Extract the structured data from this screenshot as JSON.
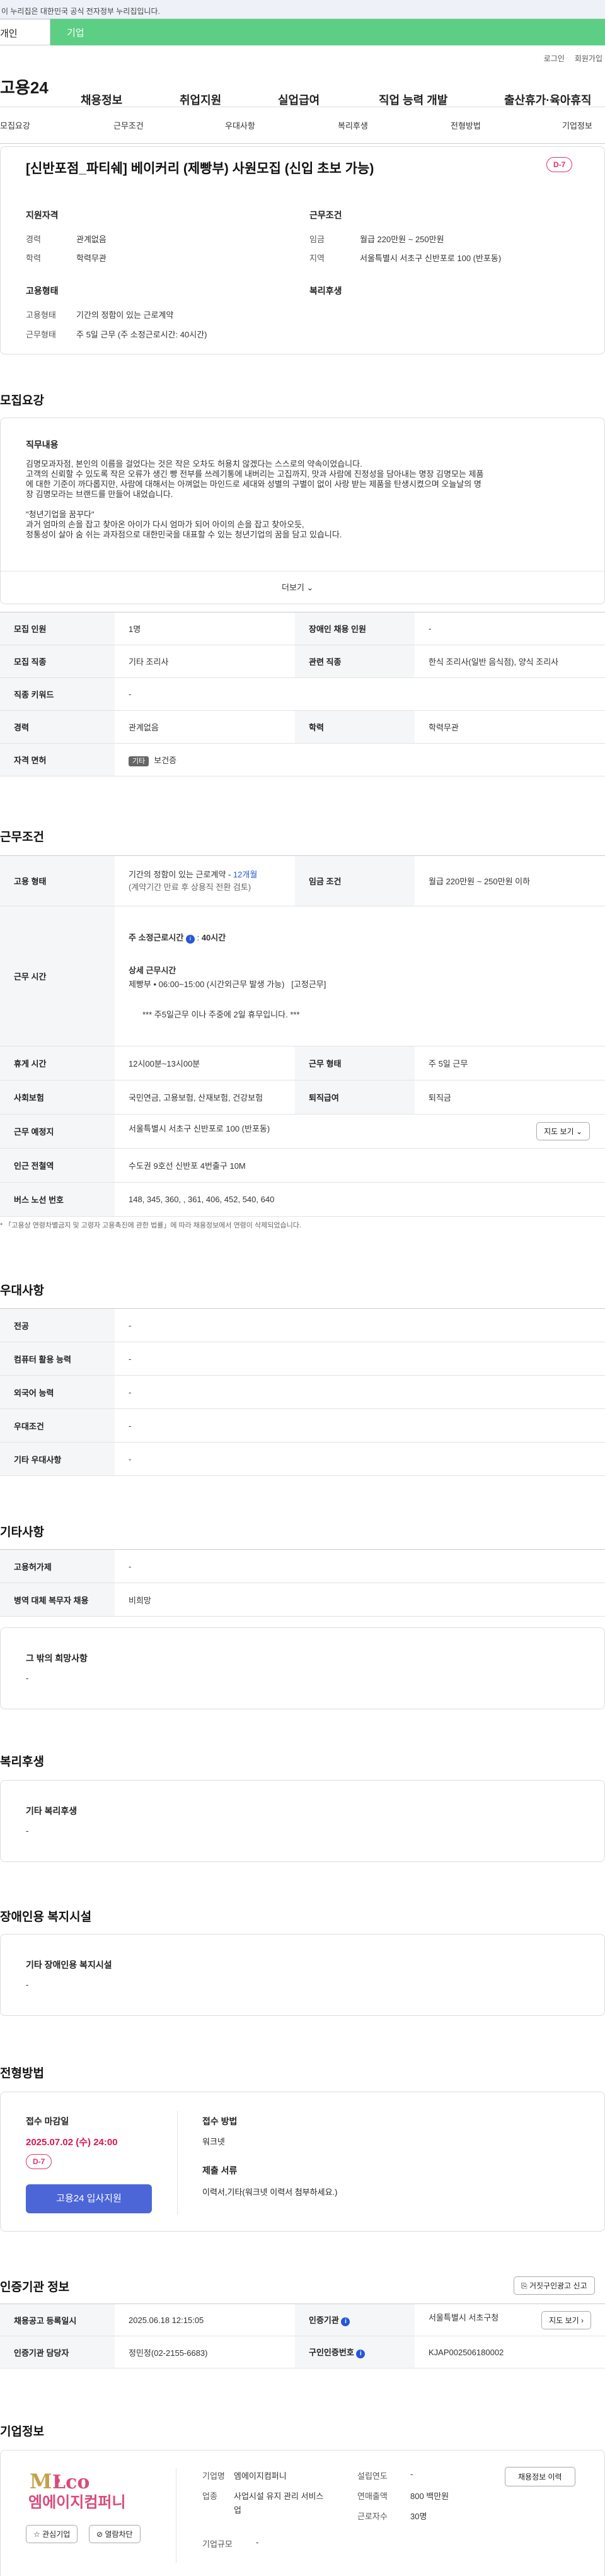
{
  "gov_banner": "이 누리집은 대한민국 공식 전자정부 누리집입니다.",
  "tabs": {
    "individual": "개인",
    "corporate": "기업"
  },
  "top_links": [
    "로그인",
    "회원가입"
  ],
  "logo": "고용24",
  "gnb": [
    "채용정보",
    "취업지원",
    "실업급여",
    "직업 능력 개발",
    "출산휴가·육아휴직"
  ],
  "anchor_nav": [
    "모집요강",
    "근무조건",
    "우대사항",
    "복리후생",
    "전형방법",
    "기업정보"
  ],
  "job": {
    "title": "[신반포점_파티쉐] 베이커리 (제빵부) 사원모집 (신입 초보 가능)",
    "dday": "D-7",
    "qual_title": "지원자격",
    "career_label": "경력",
    "career_value": "관계없음",
    "edu_label": "학력",
    "edu_value": "학력무관",
    "cond_title": "근무조건",
    "wage_label": "임금",
    "wage_value": "월급 220만원 ~ 250만원",
    "area_label": "지역",
    "area_value": "서울특별시 서초구 신반포로 100 (반포동)",
    "emp_title": "고용형태",
    "emp_label": "고용형태",
    "emp_value": "기간의 정함이 있는 근로계약",
    "worktype_label": "근무형태",
    "worktype_value": "주 5일 근무 (주 소정근로시간: 40시간)",
    "welfare_title": "복리후생"
  },
  "recruit": {
    "section_title": "모집요강",
    "duty_title": "직무내용",
    "duty_line1": "김명모과자점, 본인의 이름을 걸었다는 것은 작은 오차도 허용치 않겠다는 스스로의 약속이었습니다.",
    "duty_line2": "고객의 신뢰할 수 있도록 작은 오류가 생긴 빵 전부를 쓰레기통에 내버리는 고집까지, 맛과 사람에 진정성을 담아내는 명장 김명모는 제품",
    "duty_line3": "에 대한 기준이 까다롭지만, 사람에 대해서는 아껴없는 마인드로 세대와 성별의 구별이 없이 사랑 받는 제품을 탄생시켰으며 오늘날의 명",
    "duty_line4": "장 김명모라는 브랜드를 만들어 내었습니다.",
    "duty_line5": "\"청년기업을 꿈꾸다\"",
    "duty_line6": "과거 엄마의 손을 잡고 찾아온 아이가 다시 엄마가 되어 아이의 손을 잡고 찾아오듯,",
    "duty_line7": "정통성이 살아 숨 쉬는 과자점으로 대한민국을 대표할 수 있는 청년기업의 꿈을 담고 있습니다.",
    "more_label": "더보기",
    "rows": [
      {
        "h1": "모집 인원",
        "v1": "1명",
        "h2": "장애인 채용 인원",
        "v2": "-"
      },
      {
        "h1": "모집 직종",
        "v1": "기타 조리사",
        "h2": "관련 직종",
        "v2": "한식 조리사(일반 음식점), 양식 조리사"
      },
      {
        "h1": "직종 키워드",
        "v1": "-",
        "h2": "",
        "v2": ""
      },
      {
        "h1": "경력",
        "v1": "관계없음",
        "h2": "학력",
        "v2": "학력무관"
      }
    ],
    "license_label": "자격 면허",
    "license_badge": "기타",
    "license_value": "보건증"
  },
  "conditions": {
    "section_title": "근무조건",
    "emp_label": "고용 형태",
    "emp_line1_prefix": "기간의 정함이 있는 근로계약 - ",
    "emp_line1_months": "12개월",
    "emp_line2": "(계약기간 만료 후 상용직 전환 검토)",
    "wage_label": "임금 조건",
    "wage_value": "월급 220만원 ~ 250만원 이하",
    "hours_label": "근무 시간",
    "hours_weekly_label": "주 소정근로시간",
    "hours_weekly_value": "40시간",
    "hours_detail_title": "상세 근무시간",
    "hours_detail_line": "제빵부 • 06:00~15:00 (시간외근무 발생 가능)",
    "hours_detail_fixed": "[고정근무]",
    "hours_note": "***   주5일근무 이나   주중에 2일 휴무입니다.   ***",
    "rows": [
      {
        "h1": "휴게 시간",
        "v1": "12시00분~13시00분",
        "h2": "근무 형태",
        "v2": "주 5일 근무"
      },
      {
        "h1": "사회보험",
        "v1": "국민연금, 고용보험, 산재보험, 건강보험",
        "h2": "퇴직급여",
        "v2": "퇴직금"
      }
    ],
    "location_label": "근무 예정지",
    "location_value": "서울특별시 서초구 신반포로 100 (반포동)",
    "map_button": "지도 보기",
    "subway_label": "인근 전철역",
    "subway_value": "수도권 9호선 신반포 4번출구 10M",
    "bus_label": "버스 노선 번호",
    "bus_value": "148, 345, 360, , 361, 406, 452, 540, 640",
    "footnote": "「고용상 연령차별금지 및 고령자 고용촉진에 관한 법률」에 따라 채용정보에서 연령이 삭제되었습니다."
  },
  "preferences": {
    "section_title": "우대사항",
    "rows": [
      {
        "h": "전공",
        "v": "-"
      },
      {
        "h": "컴퓨터 활용 능력",
        "v": "-"
      },
      {
        "h": "외국어 능력",
        "v": "-"
      },
      {
        "h": "우대조건",
        "v": "-"
      },
      {
        "h": "기타 우대사항",
        "v": "-"
      }
    ]
  },
  "others": {
    "section_title": "기타사항",
    "rows": [
      {
        "h": "고용허가제",
        "v": "-"
      },
      {
        "h": "병역 대체 복무자 채용",
        "v": "비희망"
      }
    ],
    "extra_title": "그 밖의 희망사항",
    "extra_value": "-"
  },
  "welfare": {
    "section_title": "복리후생",
    "box_title": "기타 복리후생",
    "box_value": "-"
  },
  "disability": {
    "section_title": "장애인용 복지시설",
    "box_title": "기타 장애인용 복지시설",
    "box_value": "-"
  },
  "process": {
    "section_title": "전형방법",
    "deadline_title": "접수 마감일",
    "deadline_value": "2025.07.02 (수) 24:00",
    "dday": "D-7",
    "apply_button": "고용24 입사지원",
    "method_title": "접수 방법",
    "method_value": "워크넷",
    "docs_title": "제출 서류",
    "docs_value": "이력서,기타(워크넷 이력서 첨부하세요.)"
  },
  "cert": {
    "section_title": "인증기관 정보",
    "report_button": "거짓구인광고 신고",
    "reg_label": "채용공고 등록일시",
    "reg_value": "2025.06.18 12:15:05",
    "inst_label": "인증기관",
    "inst_value": "서울특별시 서초구청",
    "inst_map_button": "지도 보기",
    "manager_label": "인증기관 담당자",
    "manager_value": "정민정(02-2155-6683)",
    "reqno_label": "구인인증번호",
    "reqno_value": "KJAP002506180002"
  },
  "company": {
    "section_title": "기업정보",
    "logo_text": "엠에이지컴퍼니",
    "interest_button": "관심기업",
    "block_button": "열람차단",
    "name_label": "기업명",
    "name_value": "엠에이지컴퍼니",
    "industry_label": "업종",
    "industry_value": "사업시설 유지 관리 서비스업",
    "size_label": "기업규모",
    "size_value": "-",
    "founded_label": "설립연도",
    "founded_value": "-",
    "sales_label": "연매출액",
    "sales_value": "800 백만원",
    "staff_label": "근로자수",
    "staff_value": "30명",
    "jobs_button": "채용정보 이력"
  }
}
